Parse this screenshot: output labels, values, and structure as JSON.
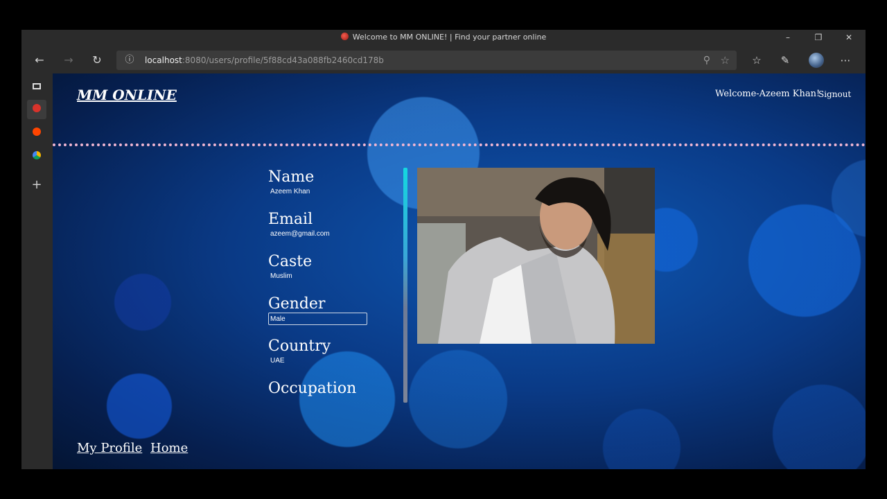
{
  "window": {
    "title": "Welcome to MM ONLINE! | Find your partner online"
  },
  "address_bar": {
    "host": "localhost",
    "path": ":8080/users/profile/5f88cd43a088fb2460cd178b"
  },
  "header": {
    "logo": "MM ONLINE",
    "welcome": "Welcome-Azeem Khan!",
    "signout": "Signout"
  },
  "profile": {
    "fields": [
      {
        "label": "Name",
        "value": "Azeem Khan"
      },
      {
        "label": "Email",
        "value": "azeem@gmail.com"
      },
      {
        "label": "Caste",
        "value": "Muslim"
      },
      {
        "label": "Gender",
        "value": "Male"
      },
      {
        "label": "Country",
        "value": "UAE"
      },
      {
        "label": "Occupation",
        "value": ""
      }
    ]
  },
  "footer_links": {
    "my_profile": "My Profile",
    "home": "Home"
  },
  "colors": {
    "page_bg": "#0a3a86",
    "divider": "#f0b6d2",
    "accent_bar": "#14d8e0"
  }
}
